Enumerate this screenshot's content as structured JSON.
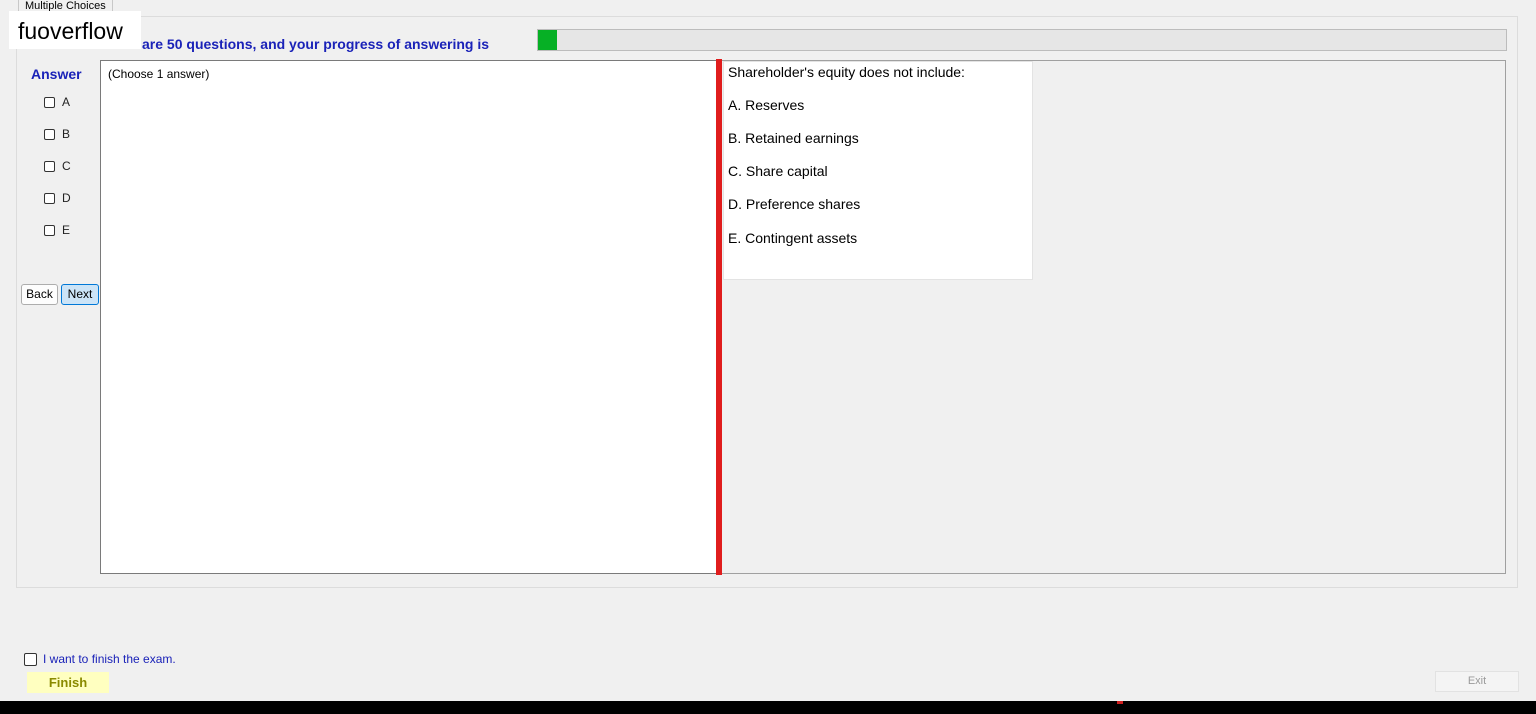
{
  "window": {
    "tab_label": "Multiple Choices"
  },
  "watermark": "fuoverflow",
  "header": {
    "progress_text": "There are 50 questions, and your progress of answering is",
    "progress_percent": 2,
    "progress_color": "#06b025"
  },
  "answer": {
    "title": "Answer",
    "options": [
      "A",
      "B",
      "C",
      "D",
      "E"
    ]
  },
  "nav": {
    "back_label": "Back",
    "next_label": "Next"
  },
  "answer_panel": {
    "instruction": "(Choose 1 answer)"
  },
  "question": {
    "text": "Shareholder's equity does not include:",
    "choices": [
      "A.  Reserves",
      "B.  Retained earnings",
      "C.  Share capital",
      "D.  Preference shares",
      "E.  Contingent assets"
    ]
  },
  "footer": {
    "finish_check_label": "I want to finish the exam.",
    "finish_label": "Finish",
    "exit_label": "Exit"
  },
  "colors": {
    "accent_text": "#1a22b8",
    "splitter": "#e01d1d"
  }
}
